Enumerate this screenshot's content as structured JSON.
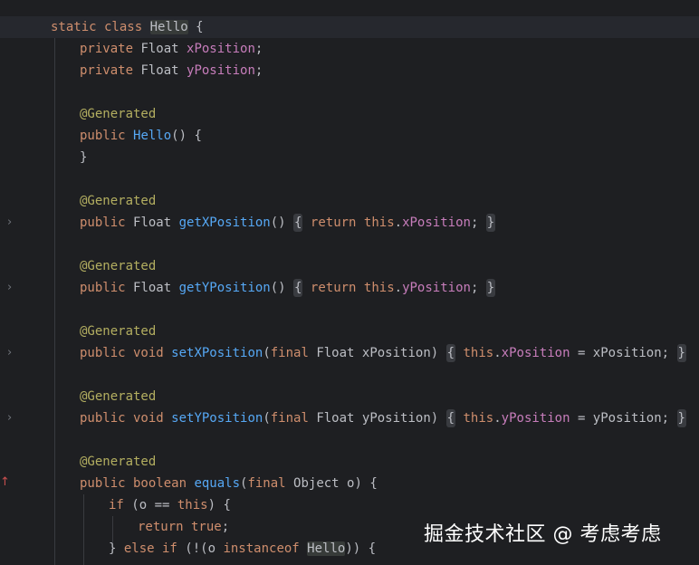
{
  "editor": {
    "lines": [
      {
        "tokens": [
          [
            "kw",
            "static class "
          ],
          [
            "plain hl-usage",
            "Hello"
          ],
          [
            "plain",
            " {"
          ]
        ]
      },
      {
        "tokens": [
          [
            "kw",
            "private "
          ],
          [
            "plain",
            "Float "
          ],
          [
            "fld",
            "xPosition"
          ],
          [
            "plain",
            ";"
          ]
        ]
      },
      {
        "tokens": [
          [
            "kw",
            "private "
          ],
          [
            "plain",
            "Float "
          ],
          [
            "fld",
            "yPosition"
          ],
          [
            "plain",
            ";"
          ]
        ]
      },
      {
        "tokens": []
      },
      {
        "tokens": [
          [
            "ann",
            "@Generated"
          ]
        ]
      },
      {
        "tokens": [
          [
            "kw",
            "public "
          ],
          [
            "fn",
            "Hello"
          ],
          [
            "plain",
            "() {"
          ]
        ]
      },
      {
        "tokens": [
          [
            "plain",
            "}"
          ]
        ]
      },
      {
        "tokens": []
      },
      {
        "tokens": [
          [
            "ann",
            "@Generated"
          ]
        ]
      },
      {
        "tokens": [
          [
            "kw",
            "public "
          ],
          [
            "plain",
            "Float "
          ],
          [
            "fn",
            "getXPosition"
          ],
          [
            "plain",
            "() "
          ],
          [
            "plain fold-box",
            "{"
          ],
          [
            "kw",
            " return "
          ],
          [
            "kw",
            "this"
          ],
          [
            "plain",
            "."
          ],
          [
            "fld",
            "xPosition"
          ],
          [
            "plain",
            "; "
          ],
          [
            "plain fold-box",
            "}"
          ]
        ]
      },
      {
        "tokens": []
      },
      {
        "tokens": [
          [
            "ann",
            "@Generated"
          ]
        ]
      },
      {
        "tokens": [
          [
            "kw",
            "public "
          ],
          [
            "plain",
            "Float "
          ],
          [
            "fn",
            "getYPosition"
          ],
          [
            "plain",
            "() "
          ],
          [
            "plain fold-box",
            "{"
          ],
          [
            "kw",
            " return "
          ],
          [
            "kw",
            "this"
          ],
          [
            "plain",
            "."
          ],
          [
            "fld",
            "yPosition"
          ],
          [
            "plain",
            "; "
          ],
          [
            "plain fold-box",
            "}"
          ]
        ]
      },
      {
        "tokens": []
      },
      {
        "tokens": [
          [
            "ann",
            "@Generated"
          ]
        ]
      },
      {
        "tokens": [
          [
            "kw",
            "public void "
          ],
          [
            "fn",
            "setXPosition"
          ],
          [
            "plain",
            "("
          ],
          [
            "kw",
            "final "
          ],
          [
            "plain",
            "Float xPosition) "
          ],
          [
            "plain fold-box",
            "{"
          ],
          [
            "kw",
            " this"
          ],
          [
            "plain",
            "."
          ],
          [
            "fld",
            "xPosition"
          ],
          [
            "plain",
            " = xPosition; "
          ],
          [
            "plain fold-box",
            "}"
          ]
        ]
      },
      {
        "tokens": []
      },
      {
        "tokens": [
          [
            "ann",
            "@Generated"
          ]
        ]
      },
      {
        "tokens": [
          [
            "kw",
            "public void "
          ],
          [
            "fn",
            "setYPosition"
          ],
          [
            "plain",
            "("
          ],
          [
            "kw",
            "final "
          ],
          [
            "plain",
            "Float yPosition) "
          ],
          [
            "plain fold-box",
            "{"
          ],
          [
            "kw",
            " this"
          ],
          [
            "plain",
            "."
          ],
          [
            "fld",
            "yPosition"
          ],
          [
            "plain",
            " = yPosition; "
          ],
          [
            "plain fold-box",
            "}"
          ]
        ]
      },
      {
        "tokens": []
      },
      {
        "tokens": [
          [
            "ann",
            "@Generated"
          ]
        ]
      },
      {
        "tokens": [
          [
            "kw",
            "public boolean "
          ],
          [
            "fn",
            "equals"
          ],
          [
            "plain",
            "("
          ],
          [
            "kw",
            "final "
          ],
          [
            "plain",
            "Object o) {"
          ]
        ]
      },
      {
        "tokens": [
          [
            "kw",
            "if "
          ],
          [
            "plain",
            "(o == "
          ],
          [
            "kw",
            "this"
          ],
          [
            "plain",
            ") {"
          ]
        ]
      },
      {
        "tokens": [
          [
            "kw",
            "return true"
          ],
          [
            "plain",
            ";"
          ]
        ]
      },
      {
        "tokens": [
          [
            "plain",
            "} "
          ],
          [
            "kw",
            "else if "
          ],
          [
            "plain",
            "(!(o "
          ],
          [
            "kw",
            "instanceof "
          ],
          [
            "plain hl-usage",
            "Hello"
          ],
          [
            "plain",
            ")) {"
          ]
        ]
      }
    ],
    "fold_icon": "chevron-right-icon",
    "fold_glyph": "›",
    "override_icon": "override-arrow-icon",
    "override_glyph": "↑"
  },
  "watermark": {
    "text": "掘金技术社区 @ 考虑考虑"
  },
  "colors": {
    "background": "#1e1f22",
    "keyword": "#cf8e6d",
    "field": "#c77dbb",
    "function": "#56a8f5",
    "annotation": "#b3ae60",
    "text": "#bcbec4"
  }
}
